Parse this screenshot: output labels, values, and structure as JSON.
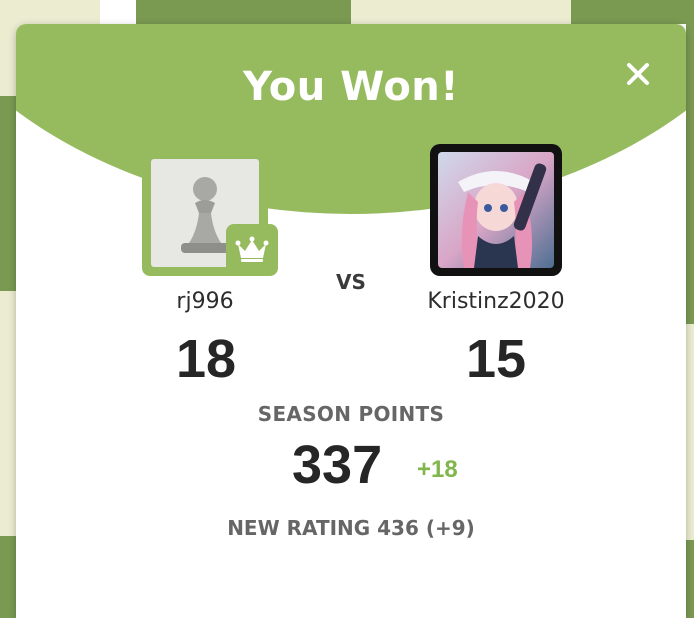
{
  "modal": {
    "title": "You Won!",
    "close_icon": "close-icon",
    "vs_label": "VS"
  },
  "players": {
    "left": {
      "username": "rj996",
      "score": "18",
      "avatar_icon": "pawn-icon",
      "badge_icon": "crown-icon"
    },
    "right": {
      "username": "Kristinz2020",
      "score": "15",
      "avatar_icon": "anime-avatar-image"
    }
  },
  "season": {
    "label": "SEASON POINTS",
    "points": "337",
    "delta": "+18"
  },
  "rating": {
    "text": "NEW RATING 436 (+9)"
  },
  "colors": {
    "accent_green": "#96bb5f",
    "delta_green": "#81b64c",
    "board_dark": "#7a9a52",
    "board_light": "#ebecd0"
  }
}
